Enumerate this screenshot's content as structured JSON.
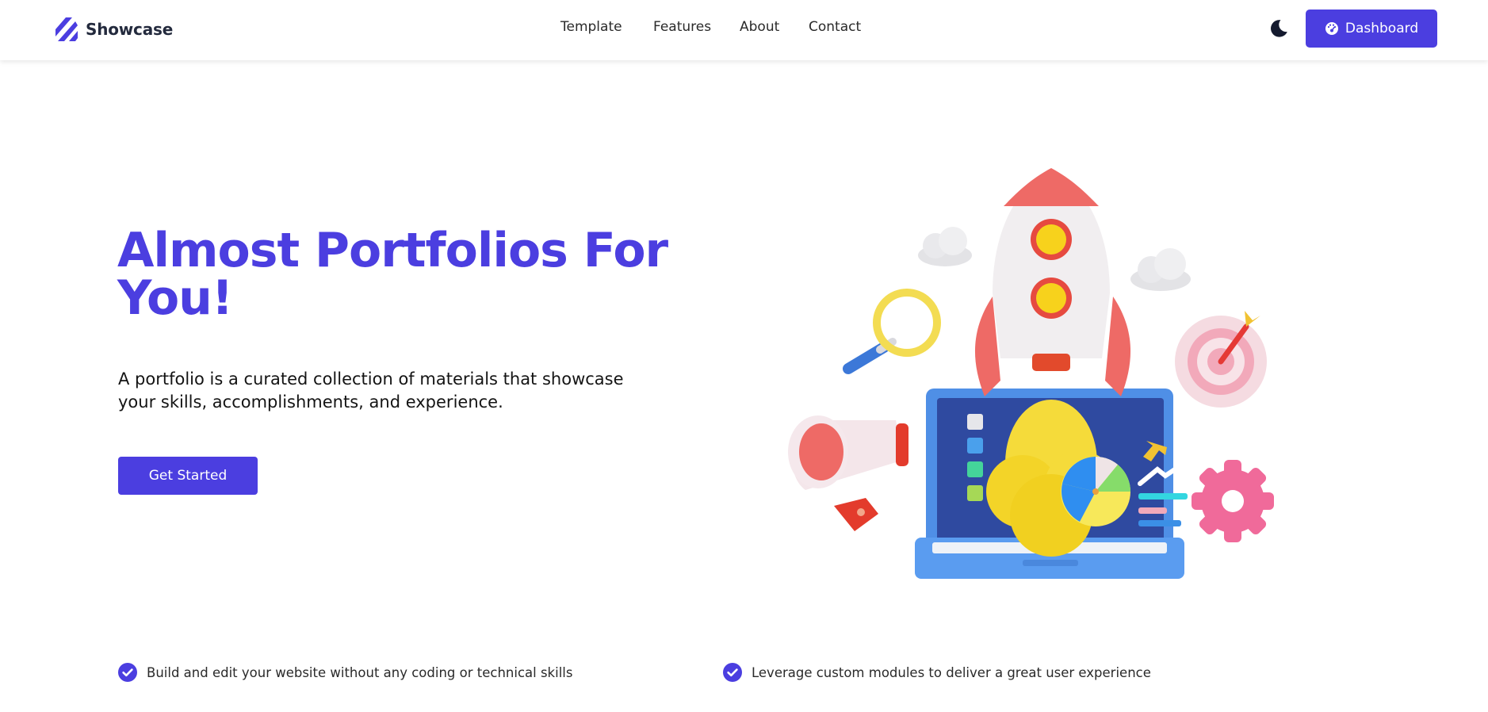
{
  "header": {
    "brand": "Showcase",
    "nav": [
      {
        "label": "Template"
      },
      {
        "label": "Features"
      },
      {
        "label": "About"
      },
      {
        "label": "Contact"
      }
    ],
    "theme_toggle_icon": "moon-icon",
    "dashboard_button": {
      "label": "Dashboard",
      "icon": "dashboard-gauge-icon"
    }
  },
  "hero": {
    "title": "Almost Portfolios For You!",
    "description": "A portfolio is a curated collection of materials that showcase your skills, accomplishments, and experience.",
    "cta_label": "Get Started",
    "illustration": "rocket-laptop-marketing-illustration"
  },
  "features": [
    {
      "text": "Build and edit your website without any coding or technical skills",
      "icon": "check-circle-icon"
    },
    {
      "text": "Leverage custom modules to deliver a great user experience",
      "icon": "check-circle-icon"
    }
  ],
  "colors": {
    "accent": "#4b3ee0",
    "text": "#141414",
    "nav_text": "#2a2a2a",
    "brand_text": "#232a3d"
  }
}
